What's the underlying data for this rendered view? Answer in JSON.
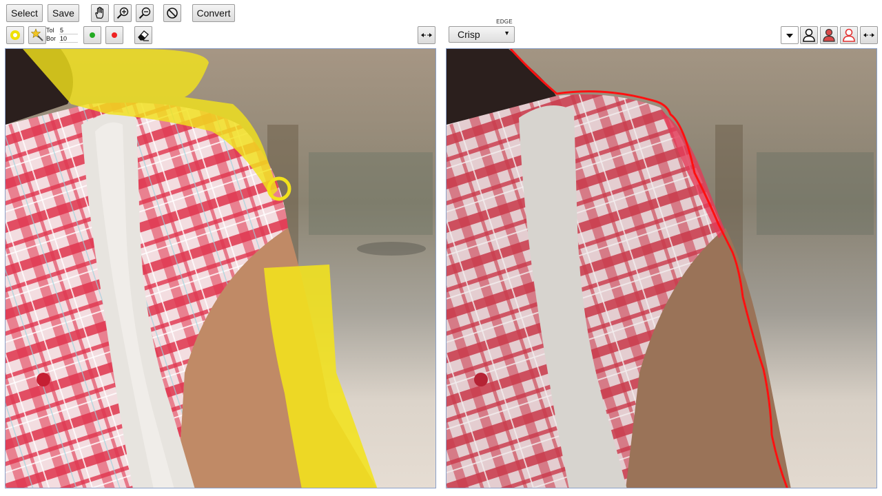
{
  "toolbar": {
    "select_label": "Select",
    "save_label": "Save",
    "convert_label": "Convert",
    "tools": [
      "hand-icon",
      "zoom-in-icon",
      "zoom-out-icon",
      "no-entry-icon"
    ]
  },
  "brush_controls": {
    "tol_label": "Tol",
    "tol_value": "5",
    "bor_label": "Bor",
    "bor_value": "10",
    "keep_color": "#22aa22",
    "remove_color": "#ee2222",
    "brush_color": "#f0e000"
  },
  "edge": {
    "label": "EDGE",
    "value": "Crisp"
  },
  "right_tools": [
    "dropdown-icon",
    "person-outline-icon",
    "person-filled-icon",
    "person-red-outline-icon",
    "swap-arrows-icon"
  ],
  "colors": {
    "highlight": "#f2e21c",
    "cut_line": "#ff1010",
    "pane_border": "#8aa0c8"
  }
}
